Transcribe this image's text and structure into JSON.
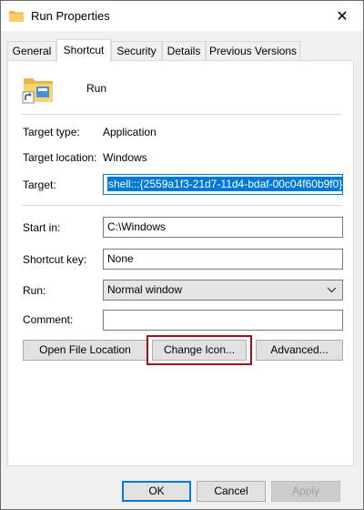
{
  "window": {
    "title": "Run Properties",
    "close_icon": "close-icon"
  },
  "tabs": [
    {
      "label": "General"
    },
    {
      "label": "Shortcut"
    },
    {
      "label": "Security"
    },
    {
      "label": "Details"
    },
    {
      "label": "Previous Versions"
    }
  ],
  "active_tab": "Shortcut",
  "header": {
    "name": "Run",
    "icon": "folder-shortcut-icon"
  },
  "info": {
    "target_type_label": "Target type:",
    "target_type_value": "Application",
    "target_location_label": "Target location:",
    "target_location_value": "Windows",
    "target_label": "Target:",
    "target_value": "shell:::{2559a1f3-21d7-11d4-bdaf-00c04f60b9f0}"
  },
  "fields": {
    "start_in_label": "Start in:",
    "start_in_value": "C:\\Windows",
    "shortcut_key_label": "Shortcut key:",
    "shortcut_key_value": "None",
    "run_label": "Run:",
    "run_value": "Normal window",
    "comment_label": "Comment:",
    "comment_value": ""
  },
  "actions": {
    "open_file_location": "Open File Location",
    "change_icon": "Change Icon...",
    "advanced": "Advanced..."
  },
  "footer": {
    "ok": "OK",
    "cancel": "Cancel",
    "apply": "Apply"
  },
  "colors": {
    "accent": "#0078d7",
    "highlight": "#a50d16"
  }
}
